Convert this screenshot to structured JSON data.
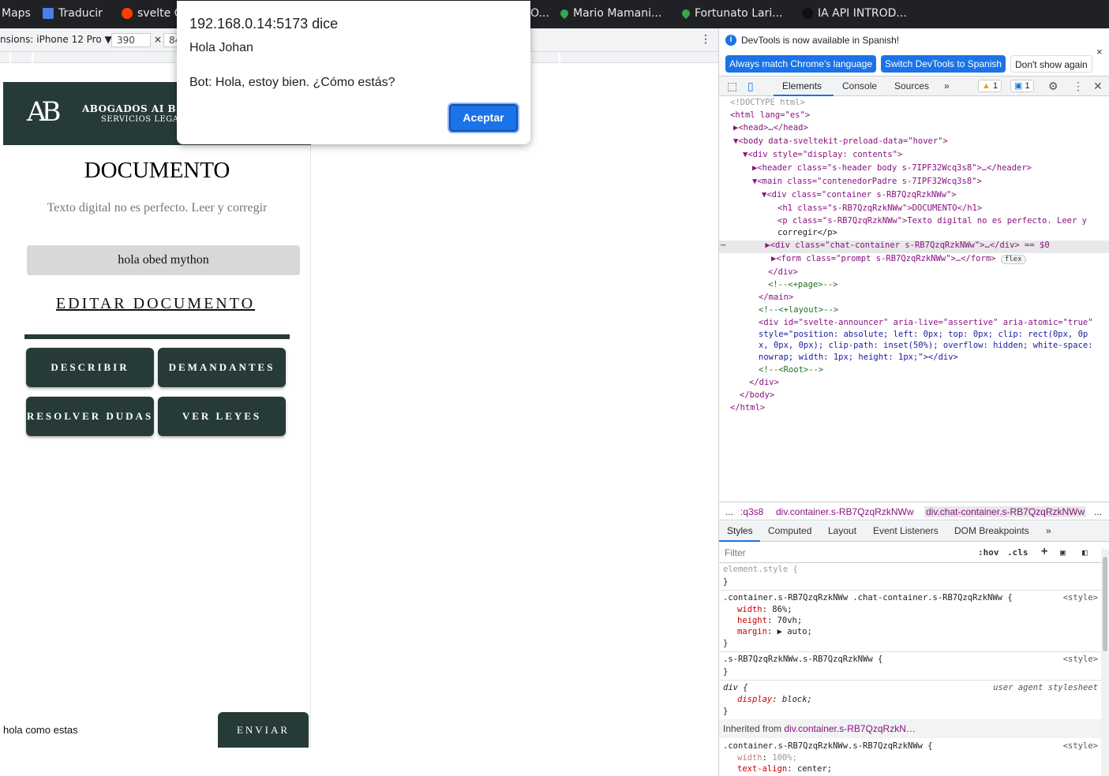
{
  "bookmarks": [
    {
      "label": "Maps",
      "icon": "maps-icon"
    },
    {
      "label": "Traducir",
      "icon": "translate-icon"
    },
    {
      "label": "svelte C",
      "icon": "svelte-icon"
    },
    {
      "label": "O...",
      "icon": "bookmark-icon"
    },
    {
      "label": "Mario Mamani...",
      "icon": "map-pin-icon"
    },
    {
      "label": "Fortunato Lari...",
      "icon": "map-pin-icon"
    },
    {
      "label": "IA API INTROD...",
      "icon": "github-icon"
    }
  ],
  "device_toolbar": {
    "device_label": "nsions: iPhone 12 Pro ▼",
    "width": "390",
    "times": "×",
    "height": "84",
    "menu": "⋮"
  },
  "site": {
    "logo": "AB",
    "brand_name": "ABOGADOS AI BO",
    "brand_tag": "SERVICIOS LEGAL",
    "title": "DOCUMENTO",
    "subtitle": "Texto digital no es perfecto. Leer y corregir",
    "chat_message": "hola obed mython",
    "edit_link": "EDITAR DOCUMENTO",
    "actions": [
      "DESCRIBIR",
      "DEMANDANTES",
      "RESOLVER DUDAS",
      "VER LEYES"
    ],
    "prompt_value": "hola como estas",
    "send_label": "ENVIAR"
  },
  "alert": {
    "origin": "192.168.0.14:5173 dice",
    "line1": "Hola Johan",
    "line2": "Bot: Hola, estoy bien. ¿Cómo estás?",
    "ok_label": "Aceptar"
  },
  "devtools": {
    "info_text": "DevTools is now available in Spanish!",
    "close": "×",
    "lang_buttons": [
      "Always match Chrome's language",
      "Switch DevTools to Spanish",
      "Don't show again"
    ],
    "tabs": [
      "Elements",
      "Console",
      "Sources",
      "»"
    ],
    "warnings": "1",
    "messages": "1",
    "dom": [
      {
        "text": "<!DOCTYPE html>"
      },
      {
        "text": "<html lang=\"es\">"
      },
      {
        "text": "▶<head>…</head>"
      },
      {
        "text": "▼<body data-sveltekit-preload-data=\"hover\">"
      },
      {
        "text": "▼<div style=\"display: contents\">"
      },
      {
        "text": "▶<header class=\"s-header body s-7IPF32Wcq3s8\">…</header>"
      },
      {
        "text": "▼<main class=\"contenedorPadre s-7IPF32Wcq3s8\">"
      },
      {
        "text": "▼<div class=\"container s-RB7QzqRzkNWw\">"
      },
      {
        "text": "<h1 class=\"s-RB7QzqRzkNWw\">DOCUMENTO</h1>"
      },
      {
        "text": "<p class=\"s-RB7QzqRzkNWw\">Texto digital no es perfecto. Leer y"
      },
      {
        "text": "corregir</p>"
      },
      {
        "text": "▶<div class=\"chat-container s-RB7QzqRzkNWw\">…</div> == $0"
      },
      {
        "text": "▶<form class=\"prompt s-RB7QzqRzkNWw\">…</form>"
      },
      {
        "text": "</div>"
      },
      {
        "text": "<!--<+page>-->"
      },
      {
        "text": "</main>"
      },
      {
        "text": "<!--<+layout>-->"
      },
      {
        "text": "<div id=\"svelte-announcer\" aria-live=\"assertive\" aria-atomic=\"true\""
      },
      {
        "text": "style=\"position: absolute; left: 0px; top: 0px; clip: rect(0px, 0p"
      },
      {
        "text": "x, 0px, 0px); clip-path: inset(50%); overflow: hidden; white-space:"
      },
      {
        "text": "nowrap; width: 1px; height: 1px;\"></div>"
      },
      {
        "text": "<!--<Root>-->"
      },
      {
        "text": "</div>"
      },
      {
        "text": "</body>"
      },
      {
        "text": "</html>"
      }
    ],
    "flex_badge": "flex",
    "breadcrumbs": [
      "...",
      ":q3s8",
      "div.container.s-RB7QzqRzkNWw",
      "div.chat-container.s-RB7QzqRzkNWw",
      "..."
    ],
    "styles_tabs": [
      "Styles",
      "Computed",
      "Layout",
      "Event Listeners",
      "DOM Breakpoints",
      "»"
    ],
    "filter_placeholder": "Filter",
    "hov": ":hov",
    "cls": ".cls",
    "rules": {
      "element_style": "element.style {",
      "close": "}",
      "r1_selector": ".container.s-RB7QzqRzkNWw .chat-container.s-RB7QzqRzkNWw {",
      "r1_source": "<style>",
      "r1_props": [
        {
          "name": "width",
          "value": "86%;"
        },
        {
          "name": "height",
          "value": "70vh;"
        },
        {
          "name": "margin",
          "value": "▶ auto;"
        }
      ],
      "r2_selector": ".s-RB7QzqRzkNWw.s-RB7QzqRzkNWw {",
      "r2_source": "<style>",
      "r3_selector": "div {",
      "r3_source": "user agent stylesheet",
      "r3_prop": {
        "name": "display",
        "value": "block;"
      },
      "inherited_label": "Inherited from",
      "inherited_from": "div.container.s-RB7QzqRzkN…",
      "r4_selector": ".container.s-RB7QzqRzkNWw.s-RB7QzqRzkNWw {",
      "r4_source": "<style>",
      "r4_props": [
        {
          "name": "width",
          "value": "100%;"
        },
        {
          "name": "text-align",
          "value": "center;"
        }
      ]
    }
  },
  "colors": {
    "brand_dark": "#263b38",
    "accent_blue": "#1a73e8"
  }
}
